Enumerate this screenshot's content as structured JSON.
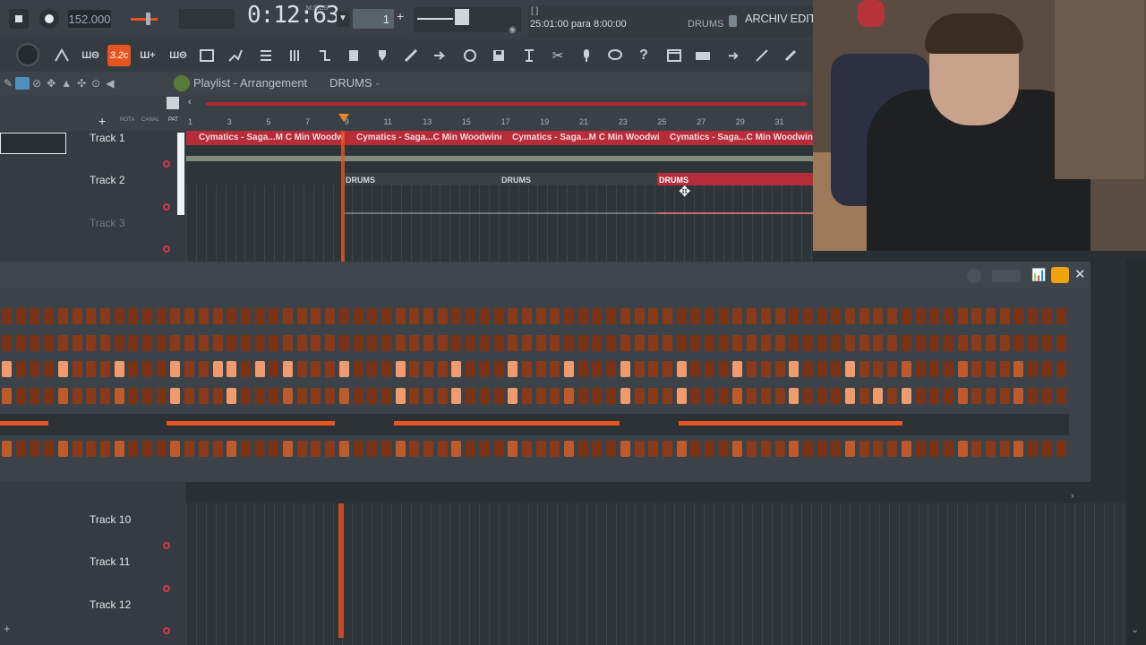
{
  "transport": {
    "tempo": "152.000",
    "time": "0:12:63",
    "time_unit": "M:S:CS",
    "pattern_number": "1"
  },
  "hint": {
    "bracket": "[ ]",
    "text": "25:01:00 para 8:00:00",
    "pattern_label": "DRUMS",
    "project_name": "ARCHIV EDITAC"
  },
  "toolbar": {
    "snap_label": "3.2c",
    "icons": [
      "cpu-icon",
      "waveform-icon",
      "typing-keyboard-icon",
      "step-icon",
      "playlist-icon",
      "piano-roll-icon",
      "browser-icon",
      "mixer-icon",
      "channel-rack-icon",
      "plugin-icon",
      "undo-icon",
      "save-icon",
      "record-icon",
      "render-icon",
      "cut-icon",
      "mic-icon",
      "chat-icon",
      "help-icon",
      "window-icon",
      "keyboard-icon",
      "arrow-icon",
      "link-icon",
      "chain-icon"
    ]
  },
  "playlist": {
    "title": "Playlist - Arrangement",
    "pattern": "DRUMS",
    "ruler_ticks": [
      "1",
      "3",
      "5",
      "7",
      "9",
      "11",
      "13",
      "15",
      "17",
      "19",
      "21",
      "23",
      "25",
      "27",
      "29",
      "31"
    ],
    "tracks": [
      "Track 1",
      "Track 2",
      "Track 3"
    ],
    "lower_tracks": [
      "Track 10",
      "Track 11",
      "Track 12"
    ],
    "audio_clip_label": "Cymatics - Saga...M C Min Woodwinds",
    "audio_clip_label_alt": "Cymatics - Saga...C Min Woodwinds",
    "drum_clip_label": "DRUMS",
    "left_labels": {
      "nota": "NOTA",
      "canal": "CANAL",
      "pat": "PAT"
    }
  },
  "colors": {
    "accent": "#e8541f",
    "clip_red": "#b72c39",
    "step_off": "#7a3114",
    "step_on": "#f19a6e"
  }
}
